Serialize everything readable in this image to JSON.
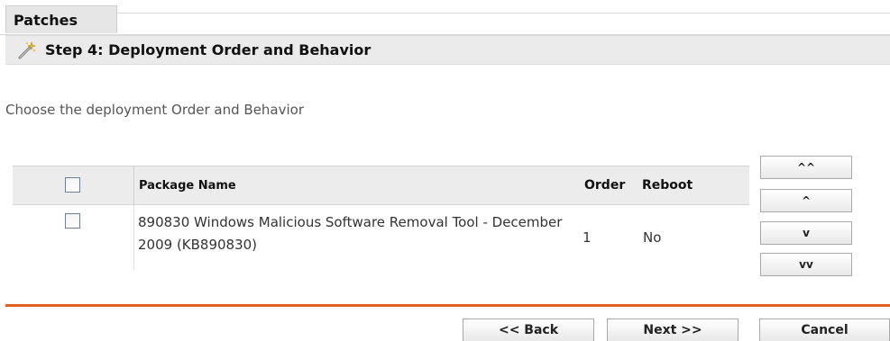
{
  "tab": {
    "label": "Patches"
  },
  "step": {
    "title": "Step 4: Deployment Order and Behavior",
    "icon": "wand-icon"
  },
  "instructions": "Choose the deployment Order and Behavior",
  "table": {
    "columns": {
      "name": "Package Name",
      "order": "Order",
      "reboot": "Reboot"
    },
    "rows": [
      {
        "name": "890830 Windows Malicious Software Removal Tool - December 2009 (KB890830)",
        "order": "1",
        "reboot": "No"
      }
    ]
  },
  "move_buttons": {
    "top": "^^",
    "up": "^",
    "down": "v",
    "bottom": "vv"
  },
  "nav": {
    "back": "<< Back",
    "next": "Next >>",
    "cancel": "Cancel"
  },
  "colors": {
    "accent_separator": "#e35f1f",
    "header_bg": "#ebebeb"
  }
}
